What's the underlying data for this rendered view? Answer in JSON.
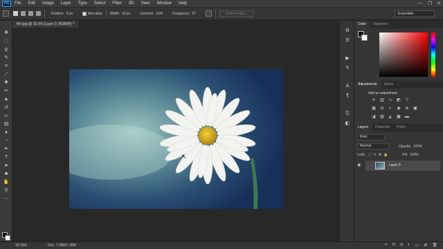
{
  "app": {
    "logo": "Ps",
    "menu": [
      "File",
      "Edit",
      "Image",
      "Layer",
      "Type",
      "Select",
      "Filter",
      "3D",
      "View",
      "Window",
      "Help"
    ],
    "window_controls": [
      "—",
      "❐",
      "✕"
    ]
  },
  "options": {
    "feather_label": "Feather:",
    "feather_value": "0 px",
    "antialias_label": "Anti-alias",
    "width_label": "Width:",
    "width_value": "10 px",
    "contrast_label": "Contrast:",
    "contrast_value": "10%",
    "frequency_label": "Frequency:",
    "frequency_value": "57",
    "refine_edge": "Refine Edge...",
    "workspace": "Essentials"
  },
  "document": {
    "tab_title": "flim.jpg @ 33.3% (Layer 0, RGB/8#) *",
    "zoom": "33.33%",
    "doc_size": "Doc: 7.38M/7.38M"
  },
  "panels": {
    "color_tabs": [
      "Color",
      "Swatches"
    ],
    "adjustments_tabs": [
      "Adjustments",
      "Styles"
    ],
    "add_adjustment": "Add an adjustment",
    "layers_tabs": [
      "Layers",
      "Channels",
      "Paths"
    ],
    "kind_label": "Kind",
    "blend_mode": "Normal",
    "opacity_label": "Opacity:",
    "opacity_value": "100%",
    "lock_label": "Lock:",
    "fill_label": "Fill:",
    "fill_value": "100%",
    "layer_name": "Layer 0"
  },
  "colors": {
    "foreground": "#000000",
    "background": "#ffffff",
    "accent": "#31a8ff"
  },
  "icons": {
    "tools": [
      "move-icon",
      "marquee-icon",
      "lasso-icon",
      "magic-wand-icon",
      "crop-icon",
      "eyedropper-icon",
      "healing-icon",
      "brush-icon",
      "stamp-icon",
      "history-brush-icon",
      "eraser-icon",
      "gradient-icon",
      "blur-icon",
      "dodge-icon",
      "pen-icon",
      "type-icon",
      "path-select-icon",
      "shape-icon",
      "hand-icon",
      "zoom-icon"
    ]
  }
}
